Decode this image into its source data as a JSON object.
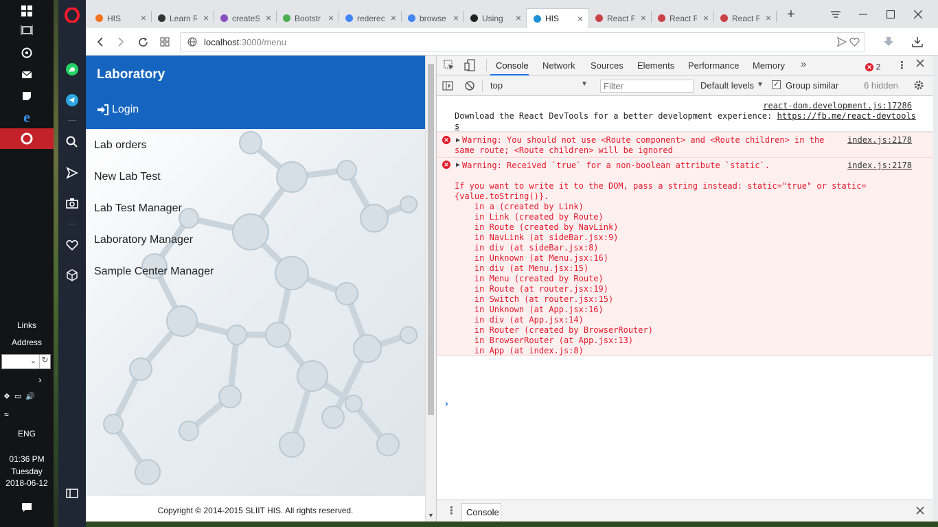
{
  "taskbar": {
    "links_label": "Links",
    "address_label": "Address",
    "language": "ENG",
    "time": "01:36 PM",
    "weekday": "Tuesday",
    "date": "2018-06-12"
  },
  "browser": {
    "tabs": [
      {
        "title": "HIS",
        "icon": "xampp-icon",
        "color": "#f4711f"
      },
      {
        "title": "Learn R",
        "icon": "eye-icon",
        "color": "#333333"
      },
      {
        "title": "createS",
        "icon": "atom-icon",
        "color": "#8a4fbf"
      },
      {
        "title": "Bootstr",
        "icon": "w3-icon",
        "color": "#4caf50"
      },
      {
        "title": "rederec",
        "icon": "google-icon",
        "color": "#4285f4"
      },
      {
        "title": "browse",
        "icon": "google-icon",
        "color": "#4285f4"
      },
      {
        "title": "Using",
        "icon": "github-icon",
        "color": "#222222"
      },
      {
        "title": "HIS",
        "icon": "react-icon",
        "color": "#1f8fd6",
        "active": true
      },
      {
        "title": "React R",
        "icon": "react-router-icon",
        "color": "#ca4245"
      },
      {
        "title": "React R",
        "icon": "react-router-icon",
        "color": "#ca4245"
      },
      {
        "title": "React R",
        "icon": "react-router-icon",
        "color": "#ca4245"
      }
    ],
    "url_host": "localhost",
    "url_path": ":3000/menu"
  },
  "app": {
    "title": "Laboratory",
    "login_label": "Login",
    "menu_items": [
      "Lab orders",
      "New Lab Test",
      "Lab Test Manager",
      "Laboratory Manager",
      "Sample Center Manager"
    ],
    "footer": "Copyright © 2014-2015 SLIIT HIS. All rights reserved."
  },
  "devtools": {
    "tabs": [
      "Console",
      "Network",
      "Sources",
      "Elements",
      "Performance",
      "Memory"
    ],
    "error_count": "2",
    "context": "top",
    "filter_placeholder": "Filter",
    "levels": "Default levels",
    "group_similar": "Group similar",
    "hidden": "6 hidden",
    "drawer_tab": "Console",
    "messages": {
      "info_source": "react-dom.development.js:17286",
      "info_line1": "Download the React DevTools for a better development experience: ",
      "info_link": "https://fb.me/react-devtools",
      "info_link_wrap": "s",
      "err1_source": "index.js:2178",
      "err1_line1": "Warning: You should not use <Route component> and <Route children> in the",
      "err1_line2": "same route; <Route children> will be ignored",
      "err2_source": "index.js:2178",
      "err2_line1": "Warning: Received `true` for a non-boolean attribute `static`.",
      "err2_body": [
        "If you want to write it to the DOM, pass a string instead: static=\"true\" or static=",
        "{value.toString()}.",
        "    in a (created by Link)",
        "    in Link (created by Route)",
        "    in Route (created by NavLink)",
        "    in NavLink (at sideBar.jsx:9)",
        "    in div (at sideBar.jsx:8)",
        "    in Unknown (at Menu.jsx:16)",
        "    in div (at Menu.jsx:15)",
        "    in Menu (created by Route)",
        "    in Route (at router.jsx:19)",
        "    in Switch (at router.jsx:15)",
        "    in Unknown (at App.jsx:16)",
        "    in div (at App.jsx:14)",
        "    in Router (created by BrowserRouter)",
        "    in BrowserRouter (at App.jsx:13)",
        "    in App (at index.js:8)"
      ]
    }
  }
}
